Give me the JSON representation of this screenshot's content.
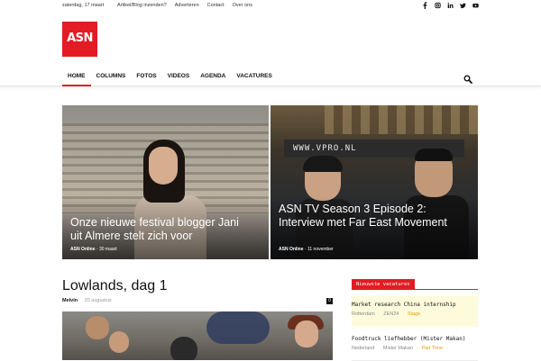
{
  "topbar": {
    "date": "zaterdag, 17 maart",
    "links": [
      "Artikel/Blog inzenden?",
      "Adverteren",
      "Contact",
      "Over ons"
    ],
    "social_icons": [
      "facebook-icon",
      "instagram-icon",
      "linkedin-icon",
      "twitter-icon",
      "youtube-icon"
    ]
  },
  "logo": {
    "text": "ASN",
    "color": "#e31b23"
  },
  "nav": {
    "items": [
      "HOME",
      "COLUMNS",
      "FOTOS",
      "VIDEOS",
      "AGENDA",
      "VACATURES"
    ],
    "active_index": 0,
    "search_icon": "search-icon"
  },
  "featured": [
    {
      "title": "Onze nieuwe festival blogger Jani uit Almere stelt zich voor",
      "author": "ASN Online",
      "date": "30 maart"
    },
    {
      "title": "ASN TV Season 3 Episode 2: Interview met Far East Movement",
      "author": "ASN Online",
      "date": "11 november",
      "sign_text": "WWW.VPRO.NL"
    }
  ],
  "article": {
    "title": "Lowlands, dag 1",
    "author": "Melvin",
    "date": "20 augustus",
    "comments": "0"
  },
  "sidebar": {
    "heading": "Nieuwste vacatures",
    "jobs": [
      {
        "title": "Market research China internship",
        "location": "Rotterdam",
        "company": "ZEN24",
        "type": "Stage"
      },
      {
        "title": "Foodtruck liefhebber (Mister Makan)",
        "location": "Nederland",
        "company": "Mister Makan",
        "type": "Part Time"
      }
    ]
  },
  "colors": {
    "accent": "#e31b23",
    "highlight_bg": "#fdfbdc",
    "job_type": "#e0a000"
  }
}
